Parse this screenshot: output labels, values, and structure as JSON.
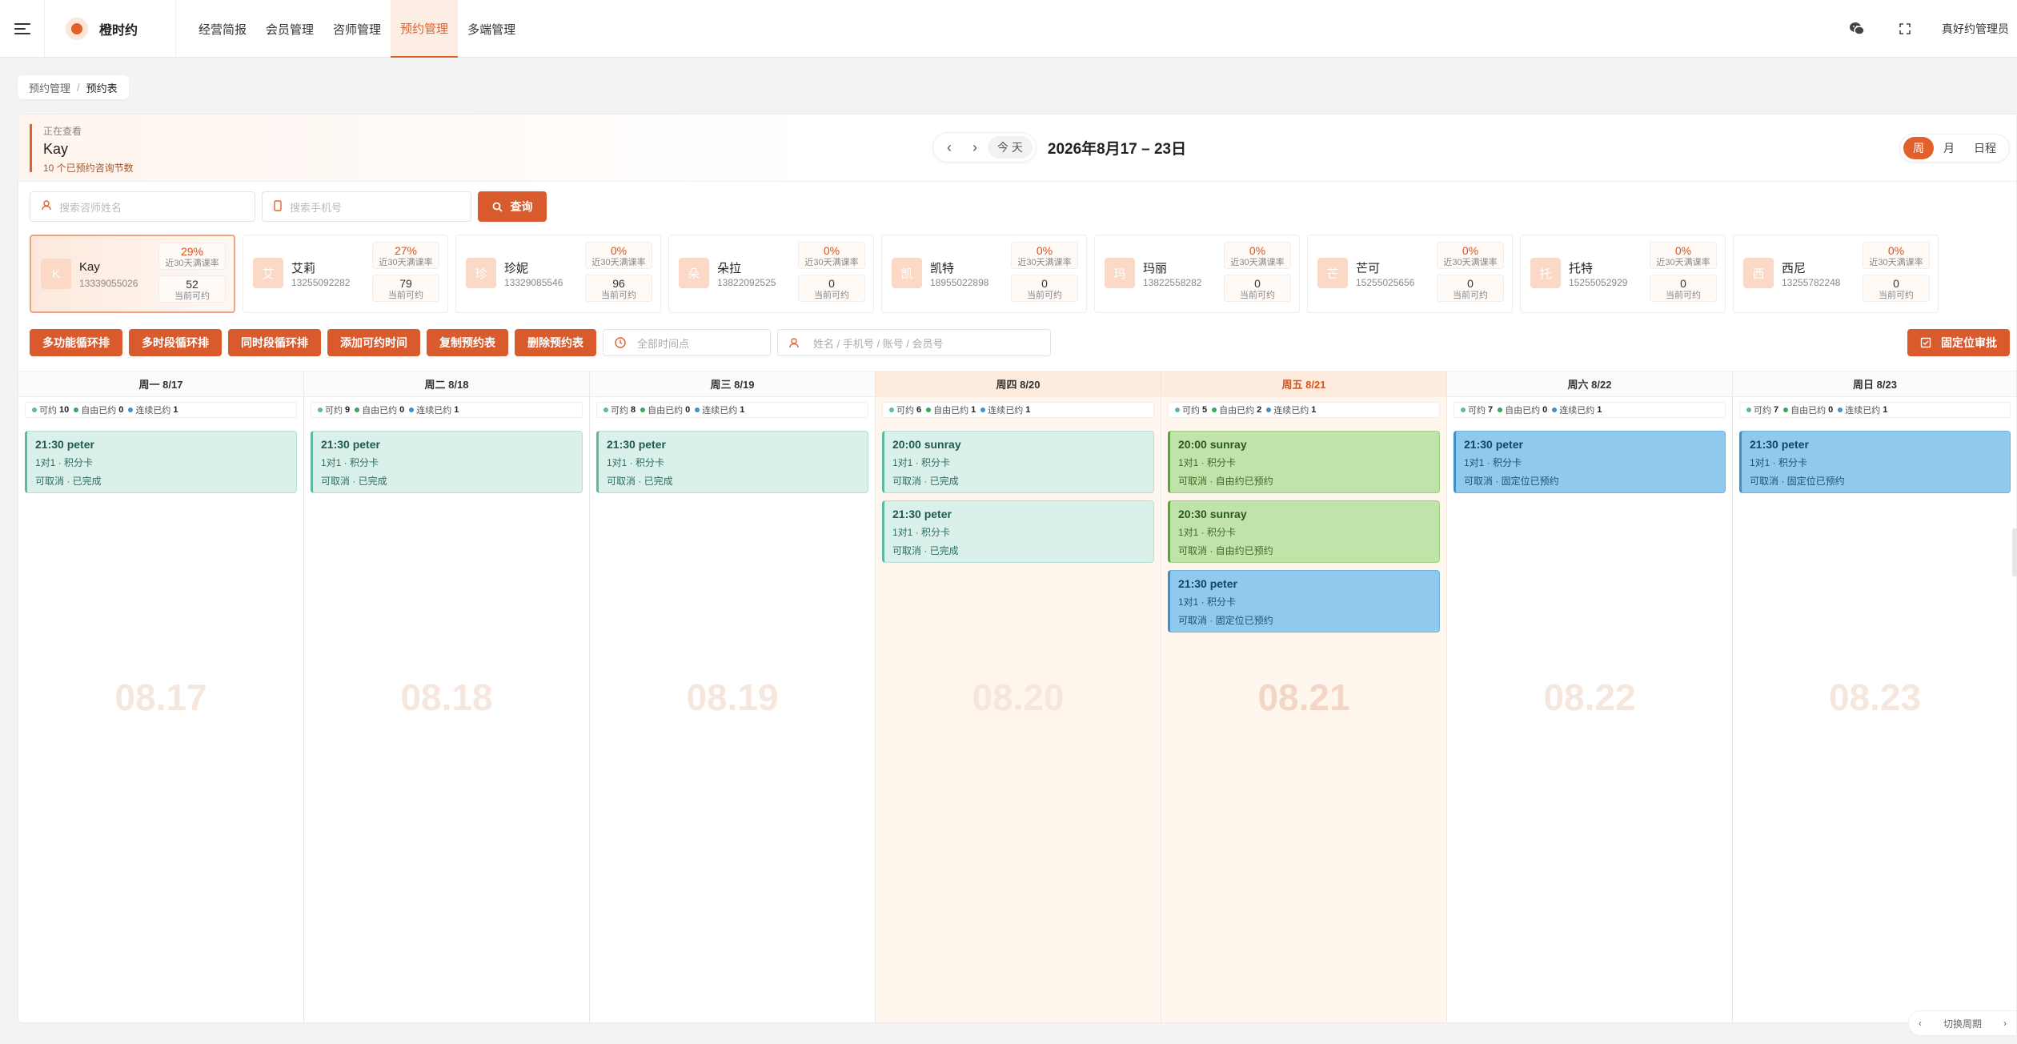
{
  "app": {
    "name": "橙时约",
    "user": "真好约管理员"
  },
  "nav": [
    "经营简报",
    "会员管理",
    "咨师管理",
    "预约管理",
    "多端管理"
  ],
  "breadcrumb": {
    "parent": "预约管理",
    "current": "预约表"
  },
  "viewing": {
    "label": "正在查看",
    "name": "Kay",
    "sub": "10 个已预约咨询节数"
  },
  "date": {
    "prev": "‹",
    "next": "›",
    "today": "今 天",
    "range": "2026年8月17 – 23日"
  },
  "views": [
    "周",
    "月",
    "日程"
  ],
  "search": {
    "name_placeholder": "搜索咨师姓名",
    "phone_placeholder": "搜索手机号",
    "query": "查询"
  },
  "consultants": [
    {
      "avatar": "K",
      "name": "Kay",
      "phone": "13339055026",
      "rate": "29%",
      "rate_label": "近30天满课率",
      "avail": "52",
      "avail_label": "当前可约"
    },
    {
      "avatar": "艾",
      "name": "艾莉",
      "phone": "13255092282",
      "rate": "27%",
      "rate_label": "近30天满课率",
      "avail": "79",
      "avail_label": "当前可约"
    },
    {
      "avatar": "珍",
      "name": "珍妮",
      "phone": "13329085546",
      "rate": "0%",
      "rate_label": "近30天满课率",
      "avail": "96",
      "avail_label": "当前可约"
    },
    {
      "avatar": "朵",
      "name": "朵拉",
      "phone": "13822092525",
      "rate": "0%",
      "rate_label": "近30天满课率",
      "avail": "0",
      "avail_label": "当前可约"
    },
    {
      "avatar": "凯",
      "name": "凯特",
      "phone": "18955022898",
      "rate": "0%",
      "rate_label": "近30天满课率",
      "avail": "0",
      "avail_label": "当前可约"
    },
    {
      "avatar": "玛",
      "name": "玛丽",
      "phone": "13822558282",
      "rate": "0%",
      "rate_label": "近30天满课率",
      "avail": "0",
      "avail_label": "当前可约"
    },
    {
      "avatar": "芒",
      "name": "芒可",
      "phone": "15255025656",
      "rate": "0%",
      "rate_label": "近30天满课率",
      "avail": "0",
      "avail_label": "当前可约"
    },
    {
      "avatar": "托",
      "name": "托特",
      "phone": "15255052929",
      "rate": "0%",
      "rate_label": "近30天满课率",
      "avail": "0",
      "avail_label": "当前可约"
    },
    {
      "avatar": "西",
      "name": "西尼",
      "phone": "13255782248",
      "rate": "0%",
      "rate_label": "近30天满课率",
      "avail": "0",
      "avail_label": "当前可约"
    }
  ],
  "actions": [
    "多功能循环排",
    "多时段循环排",
    "同时段循环排",
    "添加可约时间",
    "复制预约表",
    "删除预约表"
  ],
  "filters": {
    "time_placeholder": "全部时间点",
    "member_placeholder": "姓名 / 手机号 / 账号 / 会员号"
  },
  "fixed_approve": "固定位审批",
  "stat_labels": {
    "avail": "可约",
    "free": "自由已约",
    "cont": "连续已约"
  },
  "days": [
    {
      "header": "周一 8/17",
      "watermark": "08.17",
      "stats": [
        "10",
        "0",
        "1"
      ],
      "events": [
        {
          "time": "21:30 peter",
          "line1": "1对1 · 积分卡",
          "line2": "可取消 · 已完成",
          "kind": "teal"
        }
      ]
    },
    {
      "header": "周二 8/18",
      "watermark": "08.18",
      "stats": [
        "9",
        "0",
        "1"
      ],
      "events": [
        {
          "time": "21:30 peter",
          "line1": "1对1 · 积分卡",
          "line2": "可取消 · 已完成",
          "kind": "teal"
        }
      ]
    },
    {
      "header": "周三 8/19",
      "watermark": "08.19",
      "stats": [
        "8",
        "0",
        "1"
      ],
      "events": [
        {
          "time": "21:30 peter",
          "line1": "1对1 · 积分卡",
          "line2": "可取消 · 已完成",
          "kind": "teal"
        }
      ]
    },
    {
      "header": "周四 8/20",
      "watermark": "08.20",
      "stats": [
        "6",
        "1",
        "1"
      ],
      "events": [
        {
          "time": "20:00 sunray",
          "line1": "1对1 · 积分卡",
          "line2": "可取消 · 已完成",
          "kind": "teal"
        },
        {
          "time": "21:30 peter",
          "line1": "1对1 · 积分卡",
          "line2": "可取消 · 已完成",
          "kind": "teal"
        }
      ]
    },
    {
      "header": "周五 8/21",
      "watermark": "08.21",
      "stats": [
        "5",
        "2",
        "1"
      ],
      "events": [
        {
          "time": "20:00 sunray",
          "line1": "1对1 · 积分卡",
          "line2": "可取消 · 自由约已预约",
          "kind": "green"
        },
        {
          "time": "20:30 sunray",
          "line1": "1对1 · 积分卡",
          "line2": "可取消 · 自由约已预约",
          "kind": "green"
        },
        {
          "time": "21:30 peter",
          "line1": "1对1 · 积分卡",
          "line2": "可取消 · 固定位已预约",
          "kind": "blue"
        }
      ]
    },
    {
      "header": "周六 8/22",
      "watermark": "08.22",
      "stats": [
        "7",
        "0",
        "1"
      ],
      "events": [
        {
          "time": "21:30 peter",
          "line1": "1对1 · 积分卡",
          "line2": "可取消 · 固定位已预约",
          "kind": "blue"
        }
      ]
    },
    {
      "header": "周日 8/23",
      "watermark": "08.23",
      "stats": [
        "7",
        "0",
        "1"
      ],
      "events": [
        {
          "time": "21:30 peter",
          "line1": "1对1 · 积分卡",
          "line2": "可取消 · 固定位已预约",
          "kind": "blue"
        }
      ]
    }
  ],
  "week_switch": "切换周期",
  "colors": {
    "accent": "#e3602c",
    "free_dot": "#3aa55d",
    "cont_dot": "#3f8fcb",
    "avail_dot": "#5bb9a2"
  }
}
